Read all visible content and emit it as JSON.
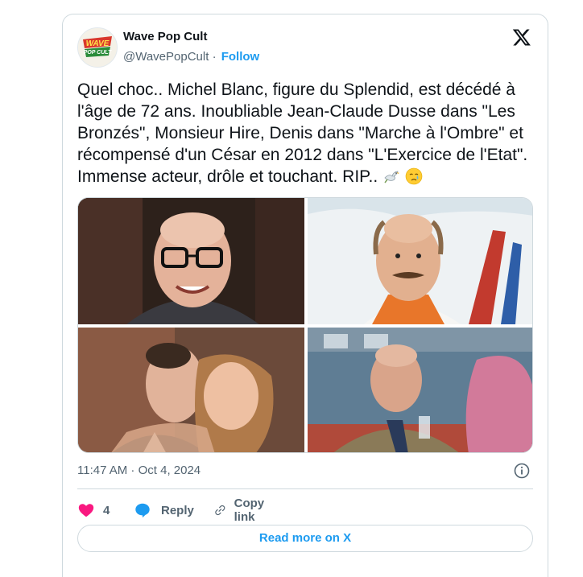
{
  "account": {
    "name": "Wave Pop Cult",
    "handle": "@WavePopCult",
    "follow_label": "Follow",
    "avatar_logo_text": "WAVE POP CULT"
  },
  "tweet": {
    "text": "Quel choc.. Michel Blanc, figure du Splendid, est décédé à l'âge de 72 ans. Inoubliable Jean-Claude Dusse dans \"Les Bronzés\", Monsieur Hire, Denis dans \"Marche à l'Ombre\" et récompensé d'un César en 2012 dans \"L'Exercice de l'Etat\". Immense acteur, drôle et touchant. RIP..",
    "emojis": [
      "dove-icon",
      "crying-face-icon"
    ],
    "timestamp": "11:47 AM · Oct 4, 2024"
  },
  "actions": {
    "likes_count": "4",
    "reply_label": "Reply",
    "copy_link_label": "Copy link"
  },
  "read_more_label": "Read more on X",
  "colors": {
    "accent": "#1d9bf0",
    "like": "#f91880",
    "text": "#0f1419",
    "secondary": "#536471",
    "border": "#cfd9de"
  }
}
